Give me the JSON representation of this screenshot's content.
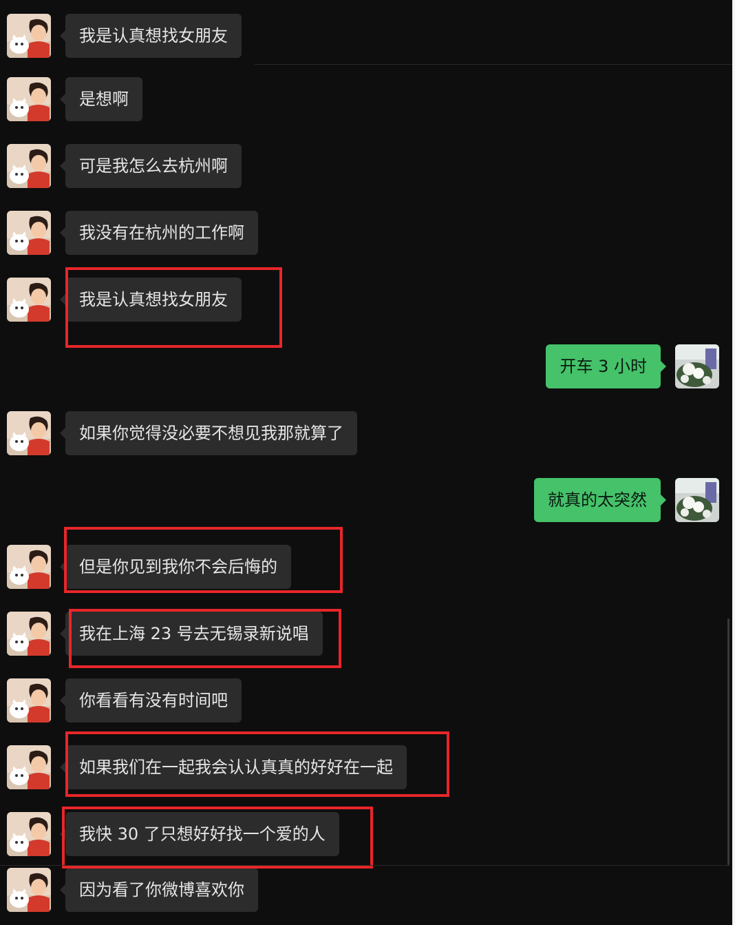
{
  "messages": [
    {
      "side": "left",
      "text": "我是认真想找女朋友"
    },
    {
      "side": "left",
      "text": "是想啊"
    },
    {
      "side": "left",
      "text": "可是我怎么去杭州啊"
    },
    {
      "side": "left",
      "text": "我没有在杭州的工作啊"
    },
    {
      "side": "left",
      "text": "我是认真想找女朋友",
      "highlighted": true
    },
    {
      "side": "right",
      "text": "开车 3 小时"
    },
    {
      "side": "left",
      "text": "如果你觉得没必要不想见我那就算了"
    },
    {
      "side": "right",
      "text": "就真的太突然"
    },
    {
      "side": "left",
      "text": "但是你见到我你不会后悔的",
      "highlighted": true
    },
    {
      "side": "left",
      "text": "我在上海 23 号去无锡录新说唱",
      "highlighted": true
    },
    {
      "side": "left",
      "text": "你看看有没有时间吧"
    },
    {
      "side": "left",
      "text": "如果我们在一起我会认认真真的好好在一起",
      "highlighted": true
    },
    {
      "side": "left",
      "text": "我快 30 了只想好好找一个爱的人",
      "highlighted": true
    },
    {
      "side": "left",
      "text": "因为看了你微博喜欢你"
    }
  ],
  "colors": {
    "background": "#0e0e0e",
    "incoming_bubble": "#2c2c2c",
    "outgoing_bubble": "#45c26a",
    "highlight_box": "#e8262a"
  },
  "icons": {
    "incoming_avatar": "cartoon-person-with-cat-avatar",
    "outgoing_avatar": "white-flowers-photo-avatar"
  }
}
